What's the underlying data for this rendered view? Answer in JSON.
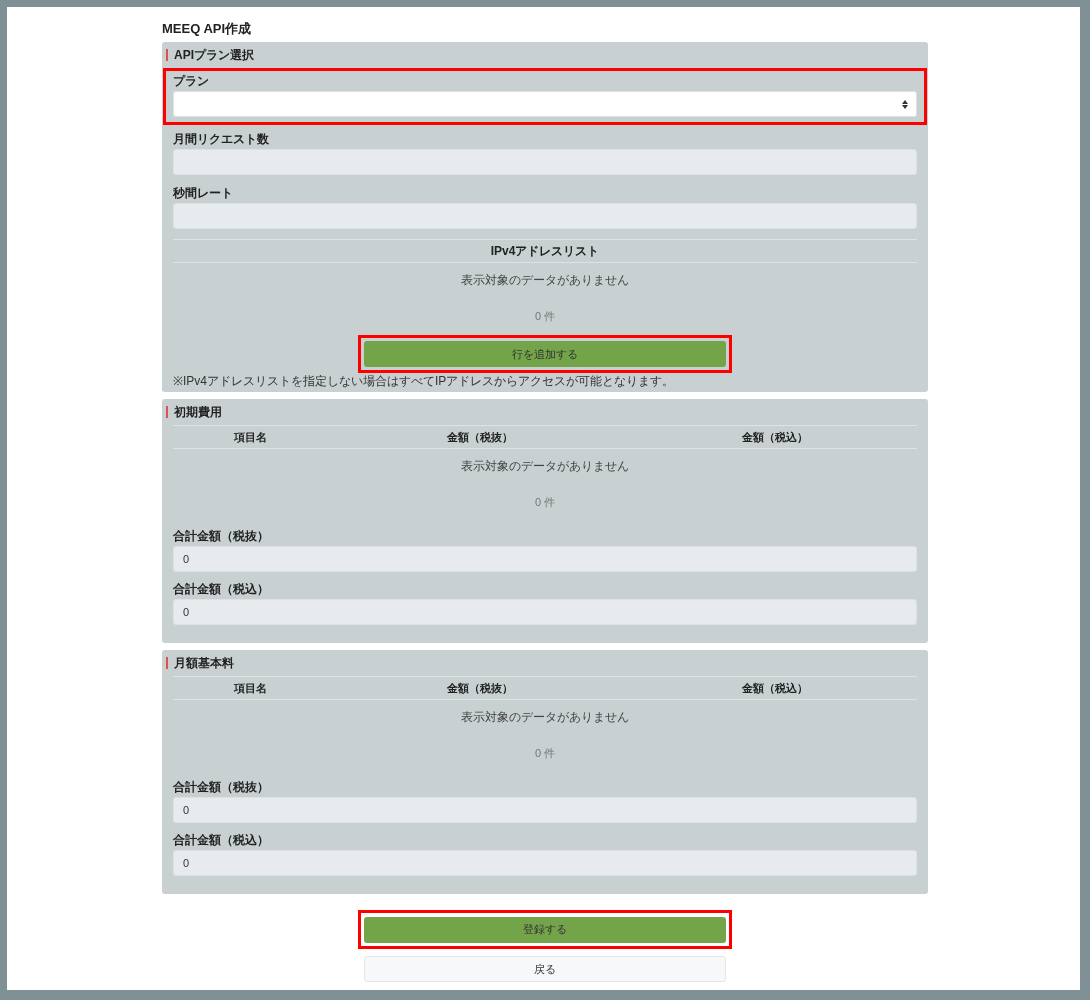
{
  "page_title": "MEEQ API作成",
  "plan_section": {
    "title": "APIプラン選択",
    "plan_field": {
      "label": "プラン",
      "highlighted": true
    },
    "fields": [
      {
        "label": "月間リクエスト数"
      },
      {
        "label": "秒間レート"
      }
    ],
    "ip_list": {
      "title": "IPv4アドレスリスト",
      "empty_message": "表示対象のデータがありません",
      "count": "0 件",
      "add_button": {
        "label": "行を追加する",
        "highlighted": true
      },
      "note": "※IPv4アドレスリストを指定しない場合はすべてIPアドレスからアクセスが可能となります。"
    }
  },
  "fee_sections": [
    {
      "title": "初期費用",
      "columns": [
        "項目名",
        "金額（税抜）",
        "金額（税込）"
      ],
      "empty_message": "表示対象のデータがありません",
      "count": "0 件",
      "totals": [
        {
          "label": "合計金額（税抜）",
          "value": "0"
        },
        {
          "label": "合計金額（税込）",
          "value": "0"
        }
      ]
    },
    {
      "title": "月額基本料",
      "columns": [
        "項目名",
        "金額（税抜）",
        "金額（税込）"
      ],
      "empty_message": "表示対象のデータがありません",
      "count": "0 件",
      "totals": [
        {
          "label": "合計金額（税抜）",
          "value": "0"
        },
        {
          "label": "合計金額（税込）",
          "value": "0"
        }
      ]
    }
  ],
  "buttons": [
    {
      "kind": "primary",
      "label": "登録する",
      "highlighted": true
    },
    {
      "kind": "secondary",
      "label": "戻る",
      "highlighted": false
    }
  ]
}
